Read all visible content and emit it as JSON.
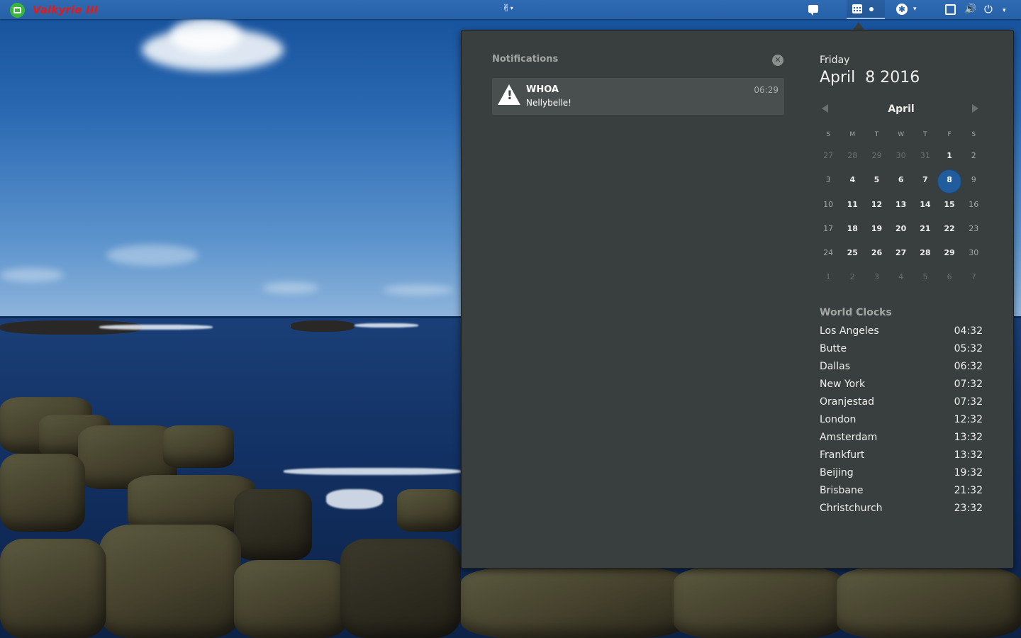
{
  "topbar": {
    "app_name": "Valkyrie III",
    "gnome_indicator": "✌",
    "volume_glyph": "🔊",
    "power_glyph": "⏻",
    "caret": "▾",
    "access_glyph": "✱"
  },
  "notifications": {
    "title": "Notifications",
    "clear_glyph": "✕",
    "items": [
      {
        "summary": "WHOA",
        "body": "Nellybelle!",
        "time": "06:29",
        "icon": "warning-icon"
      }
    ]
  },
  "date": {
    "day_name": "Friday",
    "full_date": "April  8 2016"
  },
  "calendar": {
    "month": "April",
    "weekday_headers": [
      "S",
      "M",
      "T",
      "W",
      "T",
      "F",
      "S"
    ],
    "today": "8",
    "weeks": [
      [
        "27",
        "28",
        "29",
        "30",
        "31",
        "1",
        "2"
      ],
      [
        "3",
        "4",
        "5",
        "6",
        "7",
        "8",
        "9"
      ],
      [
        "10",
        "11",
        "12",
        "13",
        "14",
        "15",
        "16"
      ],
      [
        "17",
        "18",
        "19",
        "20",
        "21",
        "22",
        "23"
      ],
      [
        "24",
        "25",
        "26",
        "27",
        "28",
        "29",
        "30"
      ],
      [
        "1",
        "2",
        "3",
        "4",
        "5",
        "6",
        "7"
      ]
    ]
  },
  "world_clocks": {
    "title": "World Clocks",
    "clocks": [
      {
        "city": "Los Angeles",
        "time": "04:32"
      },
      {
        "city": "Butte",
        "time": "05:32"
      },
      {
        "city": "Dallas",
        "time": "06:32"
      },
      {
        "city": "New York",
        "time": "07:32"
      },
      {
        "city": "Oranjestad",
        "time": "07:32"
      },
      {
        "city": "London",
        "time": "12:32"
      },
      {
        "city": "Amsterdam",
        "time": "13:32"
      },
      {
        "city": "Frankfurt",
        "time": "13:32"
      },
      {
        "city": "Beijing",
        "time": "19:32"
      },
      {
        "city": "Brisbane",
        "time": "21:32"
      },
      {
        "city": "Christchurch",
        "time": "23:32"
      }
    ]
  },
  "colors": {
    "topbar": "#2661a8",
    "popover": "#393f3f",
    "today_highlight": "#215d9c",
    "app_name": "#e21a1a",
    "app_icon": "#3db53d"
  }
}
